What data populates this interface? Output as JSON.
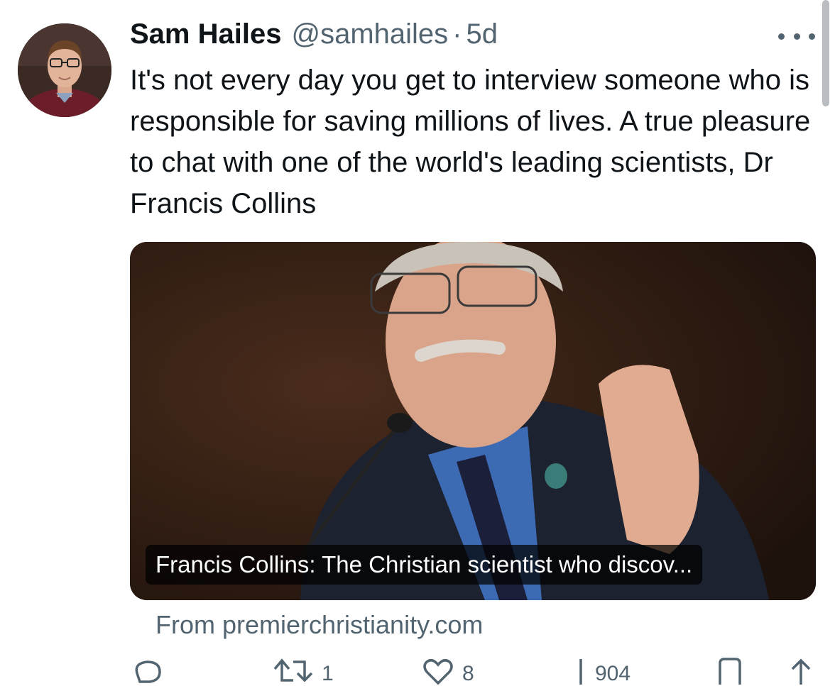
{
  "tweet": {
    "author_name": "Sam Hailes",
    "handle": "@samhailes",
    "separator": "·",
    "time": "5d",
    "text": "It's not every day you get to interview someone who is responsible for saving millions of lives. A true pleasure to chat with one of the world's leading scientists, Dr Francis Collins"
  },
  "link_card": {
    "title": "Francis Collins: The Christian scientist who discov...",
    "source": "From premierchristianity.com"
  },
  "actions": {
    "reply_count": "",
    "retweet_count": "1",
    "like_count": "8",
    "views_count": "904"
  },
  "icons": {
    "more": "more-horizontal-icon",
    "reply": "reply-icon",
    "retweet": "retweet-icon",
    "like": "heart-icon",
    "views": "views-icon",
    "bookmark": "bookmark-icon",
    "share": "share-icon"
  },
  "colors": {
    "text": "#0f1419",
    "secondary": "#536471",
    "background": "#ffffff"
  }
}
